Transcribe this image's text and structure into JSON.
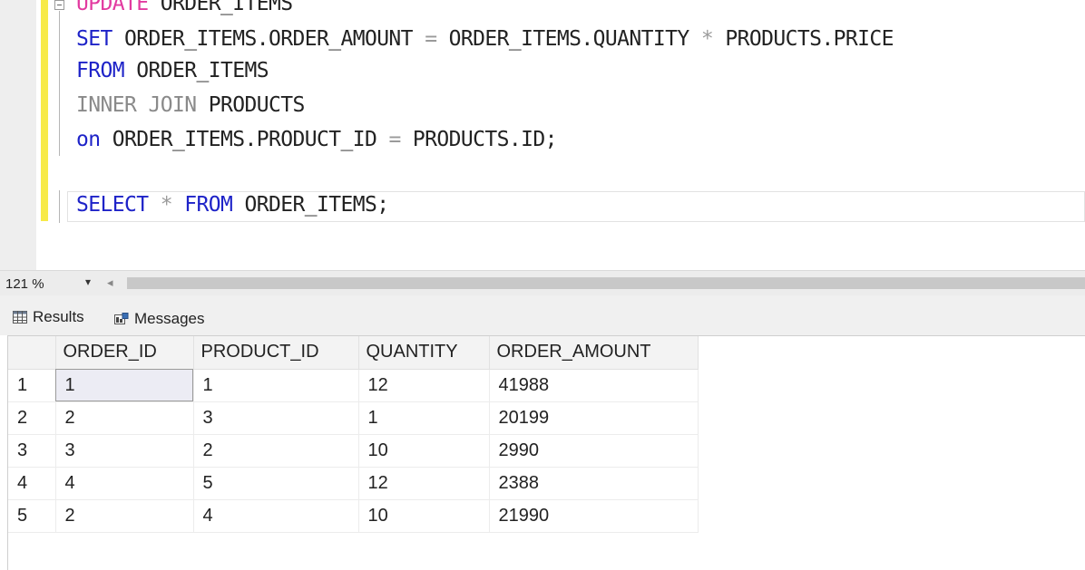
{
  "editor": {
    "lines": [
      {
        "parts": [
          {
            "t": "UPDATE",
            "c": "kw-pink"
          },
          {
            "t": " ORDER_ITEMS",
            "c": ""
          }
        ]
      },
      {
        "parts": [
          {
            "t": "SET",
            "c": "kw"
          },
          {
            "t": " ORDER_ITEMS.ORDER_AMOUNT ",
            "c": ""
          },
          {
            "t": "=",
            "c": "op"
          },
          {
            "t": " ORDER_ITEMS.QUANTITY ",
            "c": ""
          },
          {
            "t": "*",
            "c": "op"
          },
          {
            "t": " PRODUCTS.PRICE",
            "c": ""
          }
        ]
      },
      {
        "parts": [
          {
            "t": "FROM",
            "c": "kw"
          },
          {
            "t": " ORDER_ITEMS",
            "c": ""
          }
        ]
      },
      {
        "parts": [
          {
            "t": "INNER JOIN",
            "c": "kw-gray"
          },
          {
            "t": " PRODUCTS",
            "c": ""
          }
        ]
      },
      {
        "parts": [
          {
            "t": "on",
            "c": "kw"
          },
          {
            "t": " ORDER_ITEMS.PRODUCT_ID ",
            "c": ""
          },
          {
            "t": "=",
            "c": "op"
          },
          {
            "t": " PRODUCTS.ID;",
            "c": ""
          }
        ]
      },
      {
        "parts": [
          {
            "t": "SELECT",
            "c": "kw"
          },
          {
            "t": " ",
            "c": ""
          },
          {
            "t": "*",
            "c": "op"
          },
          {
            "t": " ",
            "c": ""
          },
          {
            "t": "FROM",
            "c": "kw"
          },
          {
            "t": " ORDER_ITEMS;",
            "c": ""
          }
        ]
      }
    ]
  },
  "zoom": {
    "value": "121 %",
    "dropdown_icon": "caret-down-icon",
    "scroll_left_icon": "scroll-left-icon"
  },
  "tabs": {
    "results_label": "Results",
    "messages_label": "Messages"
  },
  "grid": {
    "columns": [
      "",
      "ORDER_ID",
      "PRODUCT_ID",
      "QUANTITY",
      "ORDER_AMOUNT"
    ],
    "rows": [
      [
        "1",
        "1",
        "1",
        "12",
        "41988"
      ],
      [
        "2",
        "2",
        "3",
        "1",
        "20199"
      ],
      [
        "3",
        "3",
        "2",
        "10",
        "2990"
      ],
      [
        "4",
        "4",
        "5",
        "12",
        "2388"
      ],
      [
        "5",
        "2",
        "4",
        "10",
        "21990"
      ]
    ]
  },
  "colors": {
    "keyword": "#1e23c8",
    "update_keyword": "#e23aa0",
    "change_bar": "#f7ea48"
  }
}
